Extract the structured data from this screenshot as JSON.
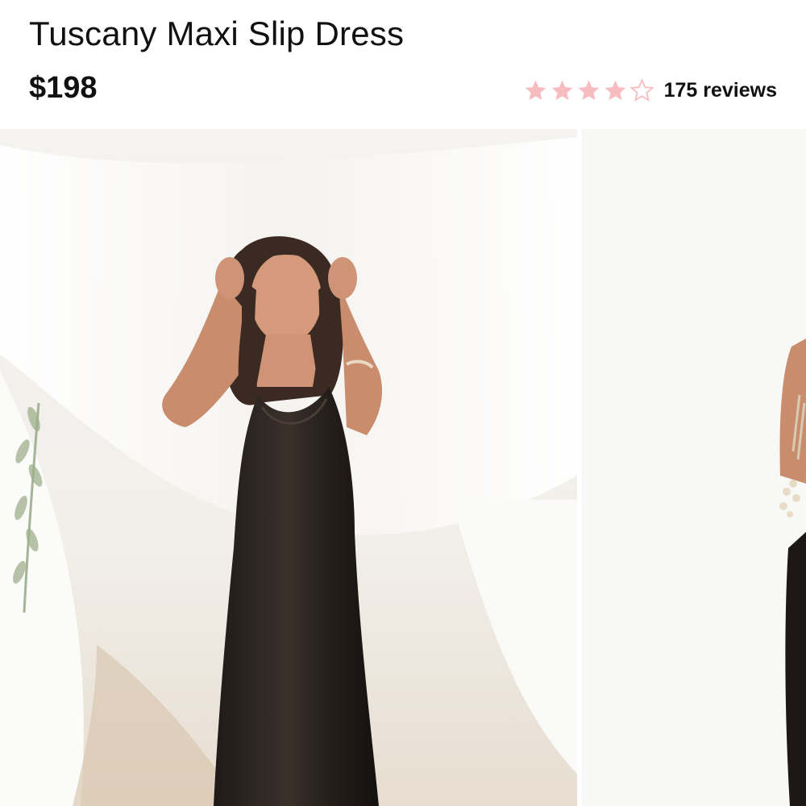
{
  "product": {
    "title": "Tuscany Maxi Slip Dress",
    "price": "$198",
    "rating": {
      "value": 4,
      "max": 5,
      "reviews_label": "175 reviews"
    }
  },
  "colors": {
    "star_filled": "#f7bcc0",
    "star_empty": "#f7bcc0",
    "dress": "#2a2320"
  },
  "gallery": {
    "images": [
      {
        "name": "model-in-black-slip-dress-photo"
      },
      {
        "name": "next-product-photo-partial"
      }
    ]
  }
}
